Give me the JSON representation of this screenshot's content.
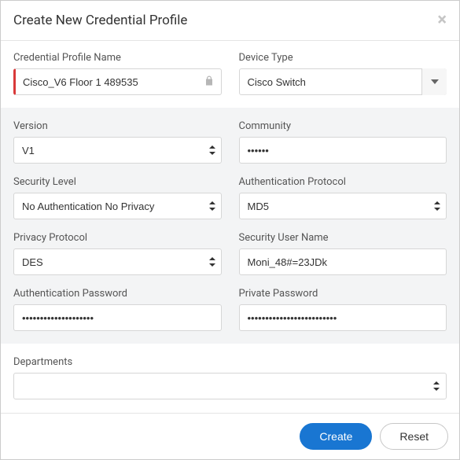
{
  "dialog": {
    "title": "Create New Credential Profile"
  },
  "top": {
    "profile_name_label": "Credential Profile Name",
    "profile_name_value": "Cisco_V6 Floor 1 489535",
    "device_type_label": "Device Type",
    "device_type_value": "Cisco Switch"
  },
  "fields": {
    "version_label": "Version",
    "version_value": "V1",
    "community_label": "Community",
    "community_value": "••••••",
    "security_level_label": "Security Level",
    "security_level_value": "No Authentication No Privacy",
    "auth_protocol_label": "Authentication Protocol",
    "auth_protocol_value": "MD5",
    "privacy_protocol_label": "Privacy Protocol",
    "privacy_protocol_value": "DES",
    "security_user_label": "Security User Name",
    "security_user_value": "Moni_48#=23JDk",
    "auth_password_label": "Authentication Password",
    "auth_password_value": "••••••••••••••••••••",
    "private_password_label": "Private Password",
    "private_password_value": "•••••••••••••••••••••••••"
  },
  "departments": {
    "label": "Departments",
    "value": ""
  },
  "footer": {
    "create_label": "Create",
    "reset_label": "Reset"
  }
}
